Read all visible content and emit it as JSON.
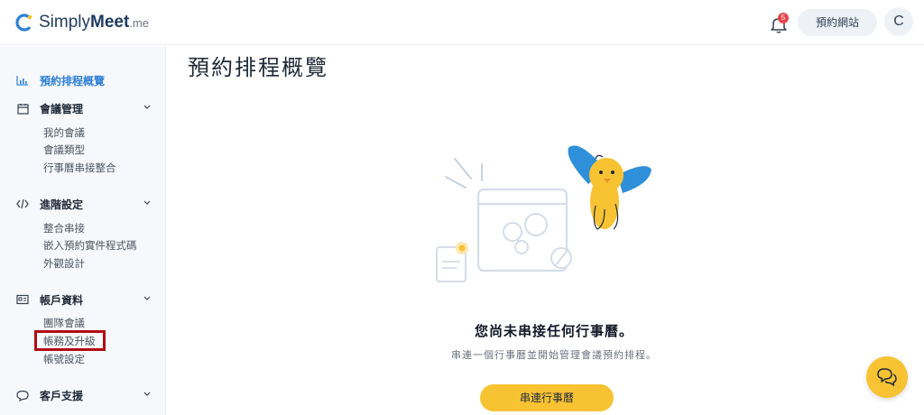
{
  "header": {
    "logo": {
      "name_part1": "Simply",
      "name_part2": "Meet",
      "tld": ".me"
    },
    "notification_count": "5",
    "booking_site_label": "預約網站",
    "avatar_initial": "C"
  },
  "sidebar": {
    "overview": {
      "label": "預約排程概覽",
      "icon": "chart-icon"
    },
    "sections": [
      {
        "label": "會議管理",
        "icon": "calendar-icon",
        "items": [
          "我的會議",
          "會議類型",
          "行事曆串接整合"
        ]
      },
      {
        "label": "進階設定",
        "icon": "code-icon",
        "items": [
          "整合串接",
          "嵌入預約實件程式碼",
          "外觀設計"
        ]
      },
      {
        "label": "帳戶資料",
        "icon": "id-card-icon",
        "items": [
          "團隊會議",
          "帳務及升級",
          "帳號設定"
        ]
      },
      {
        "label": "客戶支援",
        "icon": "chat-bubble-icon",
        "items": []
      }
    ]
  },
  "main": {
    "title": "預約排程概覽",
    "empty_title": "您尚未串接任何行事曆。",
    "empty_subtitle": "串連一個行事曆並開始管理會議預約排程。",
    "connect_button": "串連行事曆"
  },
  "colors": {
    "accent_blue": "#2f80d6",
    "accent_yellow": "#f7c333",
    "highlight_red": "#b10d13",
    "badge_red": "#e5484d"
  }
}
